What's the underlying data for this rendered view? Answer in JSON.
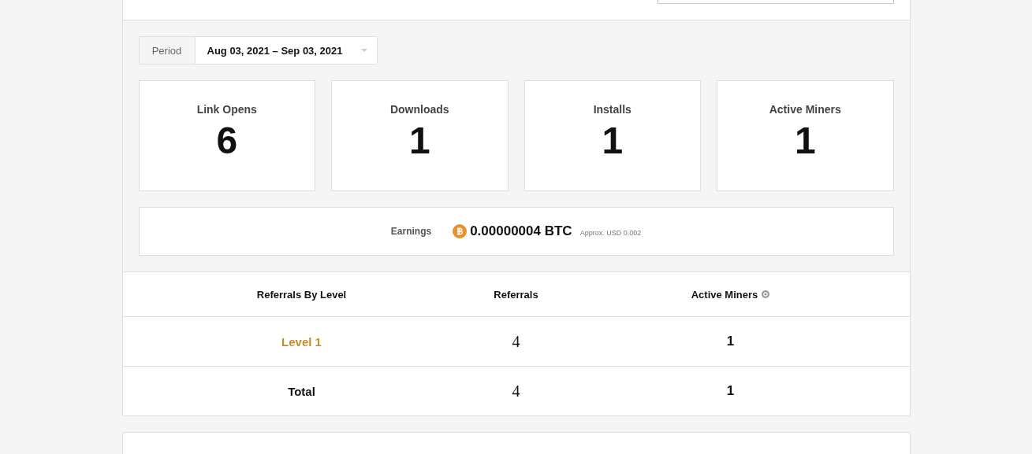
{
  "period": {
    "label": "Period",
    "value": "Aug 03, 2021 – Sep 03, 2021"
  },
  "stats": [
    {
      "label": "Link Opens",
      "value": "6"
    },
    {
      "label": "Downloads",
      "value": "1"
    },
    {
      "label": "Installs",
      "value": "1"
    },
    {
      "label": "Active Miners",
      "value": "1"
    }
  ],
  "earnings": {
    "label": "Earnings",
    "amount": "0.00000004 BTC",
    "approx": "Approx. USD 0.002"
  },
  "table": {
    "columns": [
      {
        "label": "Referrals By Level",
        "help": false
      },
      {
        "label": "Referrals",
        "help": false
      },
      {
        "label": "Active Miners",
        "help": true
      }
    ],
    "rows": [
      {
        "kind": "level",
        "cells": [
          "Level 1",
          "4",
          "1"
        ]
      },
      {
        "kind": "total",
        "cells": [
          "Total",
          "4",
          "1"
        ]
      }
    ]
  }
}
